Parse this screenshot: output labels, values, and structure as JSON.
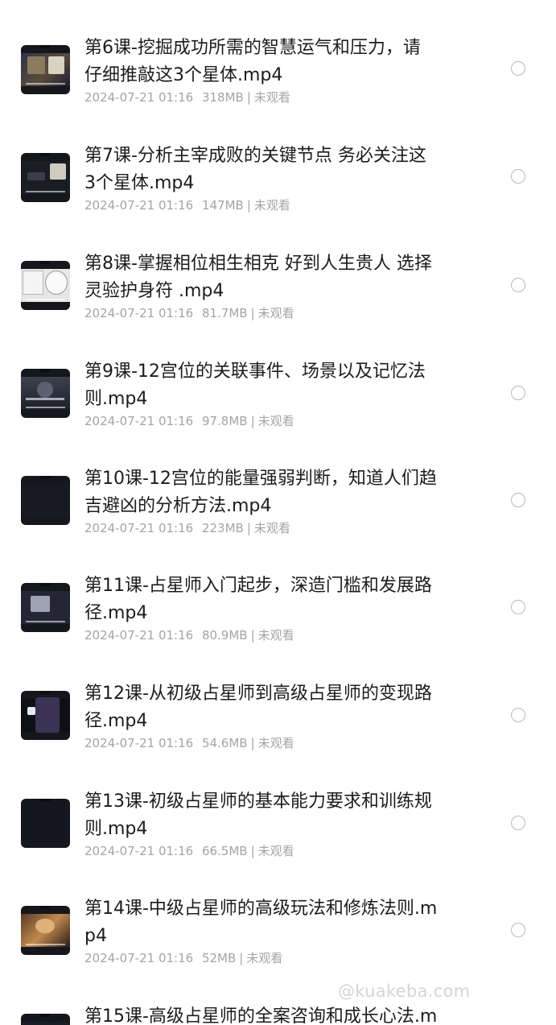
{
  "items": [
    {
      "title": "第6课-挖掘成功所需的智慧运气和压力，请\n仔细推敲这3个星体.mp4",
      "date": "2024-07-21 01:16",
      "size": "318MB",
      "status": "未观看",
      "thumb_icon": "video-thumbnail"
    },
    {
      "title": "第7课-分析主宰成败的关键节点 务必关注这\n3个星体.mp4",
      "date": "2024-07-21 01:16",
      "size": "147MB",
      "status": "未观看",
      "thumb_icon": "video-thumbnail"
    },
    {
      "title": "第8课-掌握相位相生相克 好到人生贵人 选择\n灵验护身符 .mp4",
      "date": "2024-07-21 01:16",
      "size": "81.7MB",
      "status": "未观看",
      "thumb_icon": "video-thumbnail"
    },
    {
      "title": "第9课-12宫位的关联事件、场景以及记忆法\n则.mp4",
      "date": "2024-07-21 01:16",
      "size": "97.8MB",
      "status": "未观看",
      "thumb_icon": "video-thumbnail"
    },
    {
      "title": "第10课-12宫位的能量强弱判断，知道人们趋\n吉避凶的分析方法.mp4",
      "date": "2024-07-21 01:16",
      "size": "223MB",
      "status": "未观看",
      "thumb_icon": "video-thumbnail"
    },
    {
      "title": "第11课-占星师入门起步，深造门槛和发展路\n径.mp4",
      "date": "2024-07-21 01:16",
      "size": "80.9MB",
      "status": "未观看",
      "thumb_icon": "video-thumbnail"
    },
    {
      "title": "第12课-从初级占星师到高级占星师的变现路\n径.mp4",
      "date": "2024-07-21 01:16",
      "size": "54.6MB",
      "status": "未观看",
      "thumb_icon": "video-thumbnail"
    },
    {
      "title": "第13课-初级占星师的基本能力要求和训练规\n则.mp4",
      "date": "2024-07-21 01:16",
      "size": "66.5MB",
      "status": "未观看",
      "thumb_icon": "video-thumbnail"
    },
    {
      "title": "第14课-中级占星师的高级玩法和修炼法则.m\np4",
      "date": "2024-07-21 01:16",
      "size": "52MB",
      "status": "未观看",
      "thumb_icon": "video-thumbnail"
    },
    {
      "title": "第15课-高级占星师的全案咨询和成长心法.m",
      "date": "",
      "size": "",
      "status": "",
      "thumb_icon": "video-thumbnail"
    }
  ],
  "separator": "|",
  "watermark": "@kuakeba.com",
  "colors": {
    "title": "#1c1c1c",
    "meta": "#a4a4a4",
    "radio_border": "#b9b9b9",
    "background": "#ffffff"
  }
}
